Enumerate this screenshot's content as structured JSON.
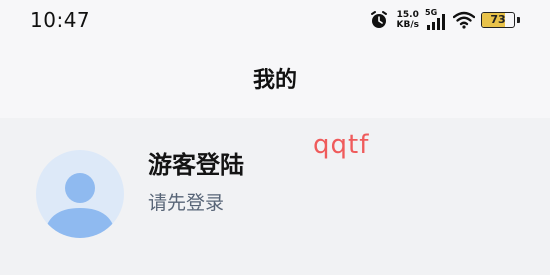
{
  "status_bar": {
    "time": "10:47",
    "net_speed_value": "15.0",
    "net_speed_unit": "KB/s",
    "network_type": "5G",
    "battery_percent": "73",
    "battery_level": 0.73,
    "icons": [
      "alarm-icon",
      "signal-icon",
      "wifi-icon",
      "battery-icon"
    ],
    "battery_color": "#e8c24a"
  },
  "header": {
    "title": "我的"
  },
  "profile": {
    "username": "游客登陆",
    "login_hint": "请先登录",
    "avatar_icon": "user-avatar-icon",
    "avatar_bg_color": "#dde9f8",
    "avatar_figure_color": "#8fbaf0"
  },
  "overlay": {
    "watermark_text": "qqtf",
    "watermark_color": "#ef5b5b"
  }
}
